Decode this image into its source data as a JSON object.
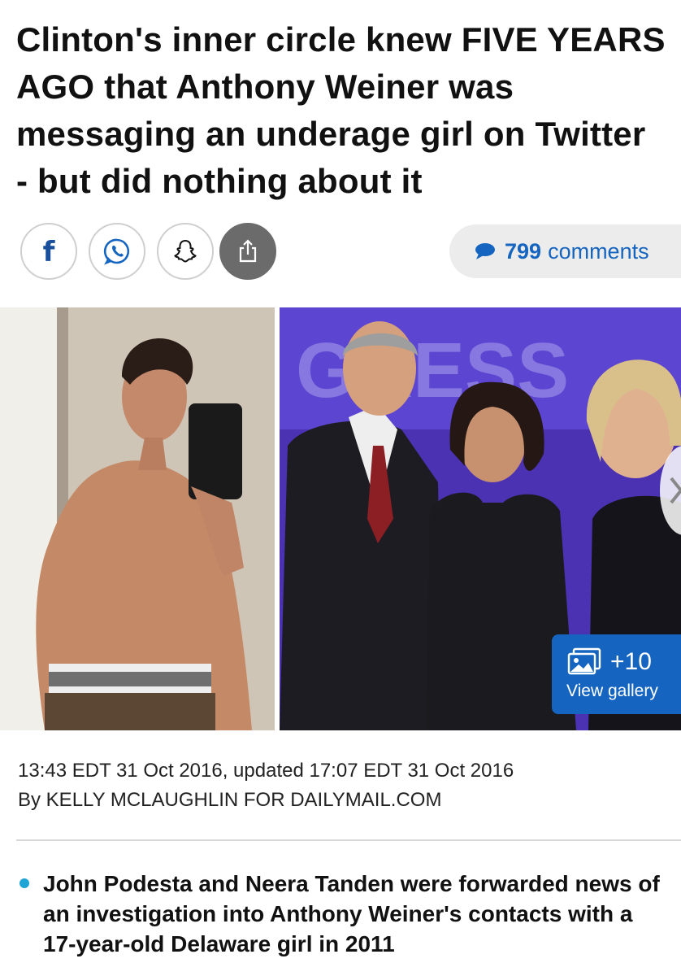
{
  "article": {
    "headline": "Clinton's inner circle knew FIVE YEARS AGO that Anthony Weiner was messaging an underage girl on Twitter - but did nothing about it"
  },
  "share": {
    "facebook_glyph": "f",
    "icons": [
      "facebook-icon",
      "whatsapp-icon",
      "snapchat-icon",
      "share-icon"
    ],
    "comment_count": "799",
    "comment_label": "comments"
  },
  "gallery": {
    "count": "+10",
    "label": "View gallery"
  },
  "meta": {
    "dateline": "13:43 EDT 31 Oct 2016, updated 17:07 EDT 31 Oct 2016",
    "byline": "By KELLY MCLAUGHLIN FOR DAILYMAIL.COM"
  },
  "bullets": [
    "John Podesta and Neera Tanden were forwarded news of an investigation into Anthony Weiner's contacts with a 17-year-old Delaware girl in 2011"
  ],
  "colors": {
    "accent_blue": "#1565c0",
    "bullet_blue": "#1fa4d6",
    "share_active": "#6b6b6b"
  }
}
